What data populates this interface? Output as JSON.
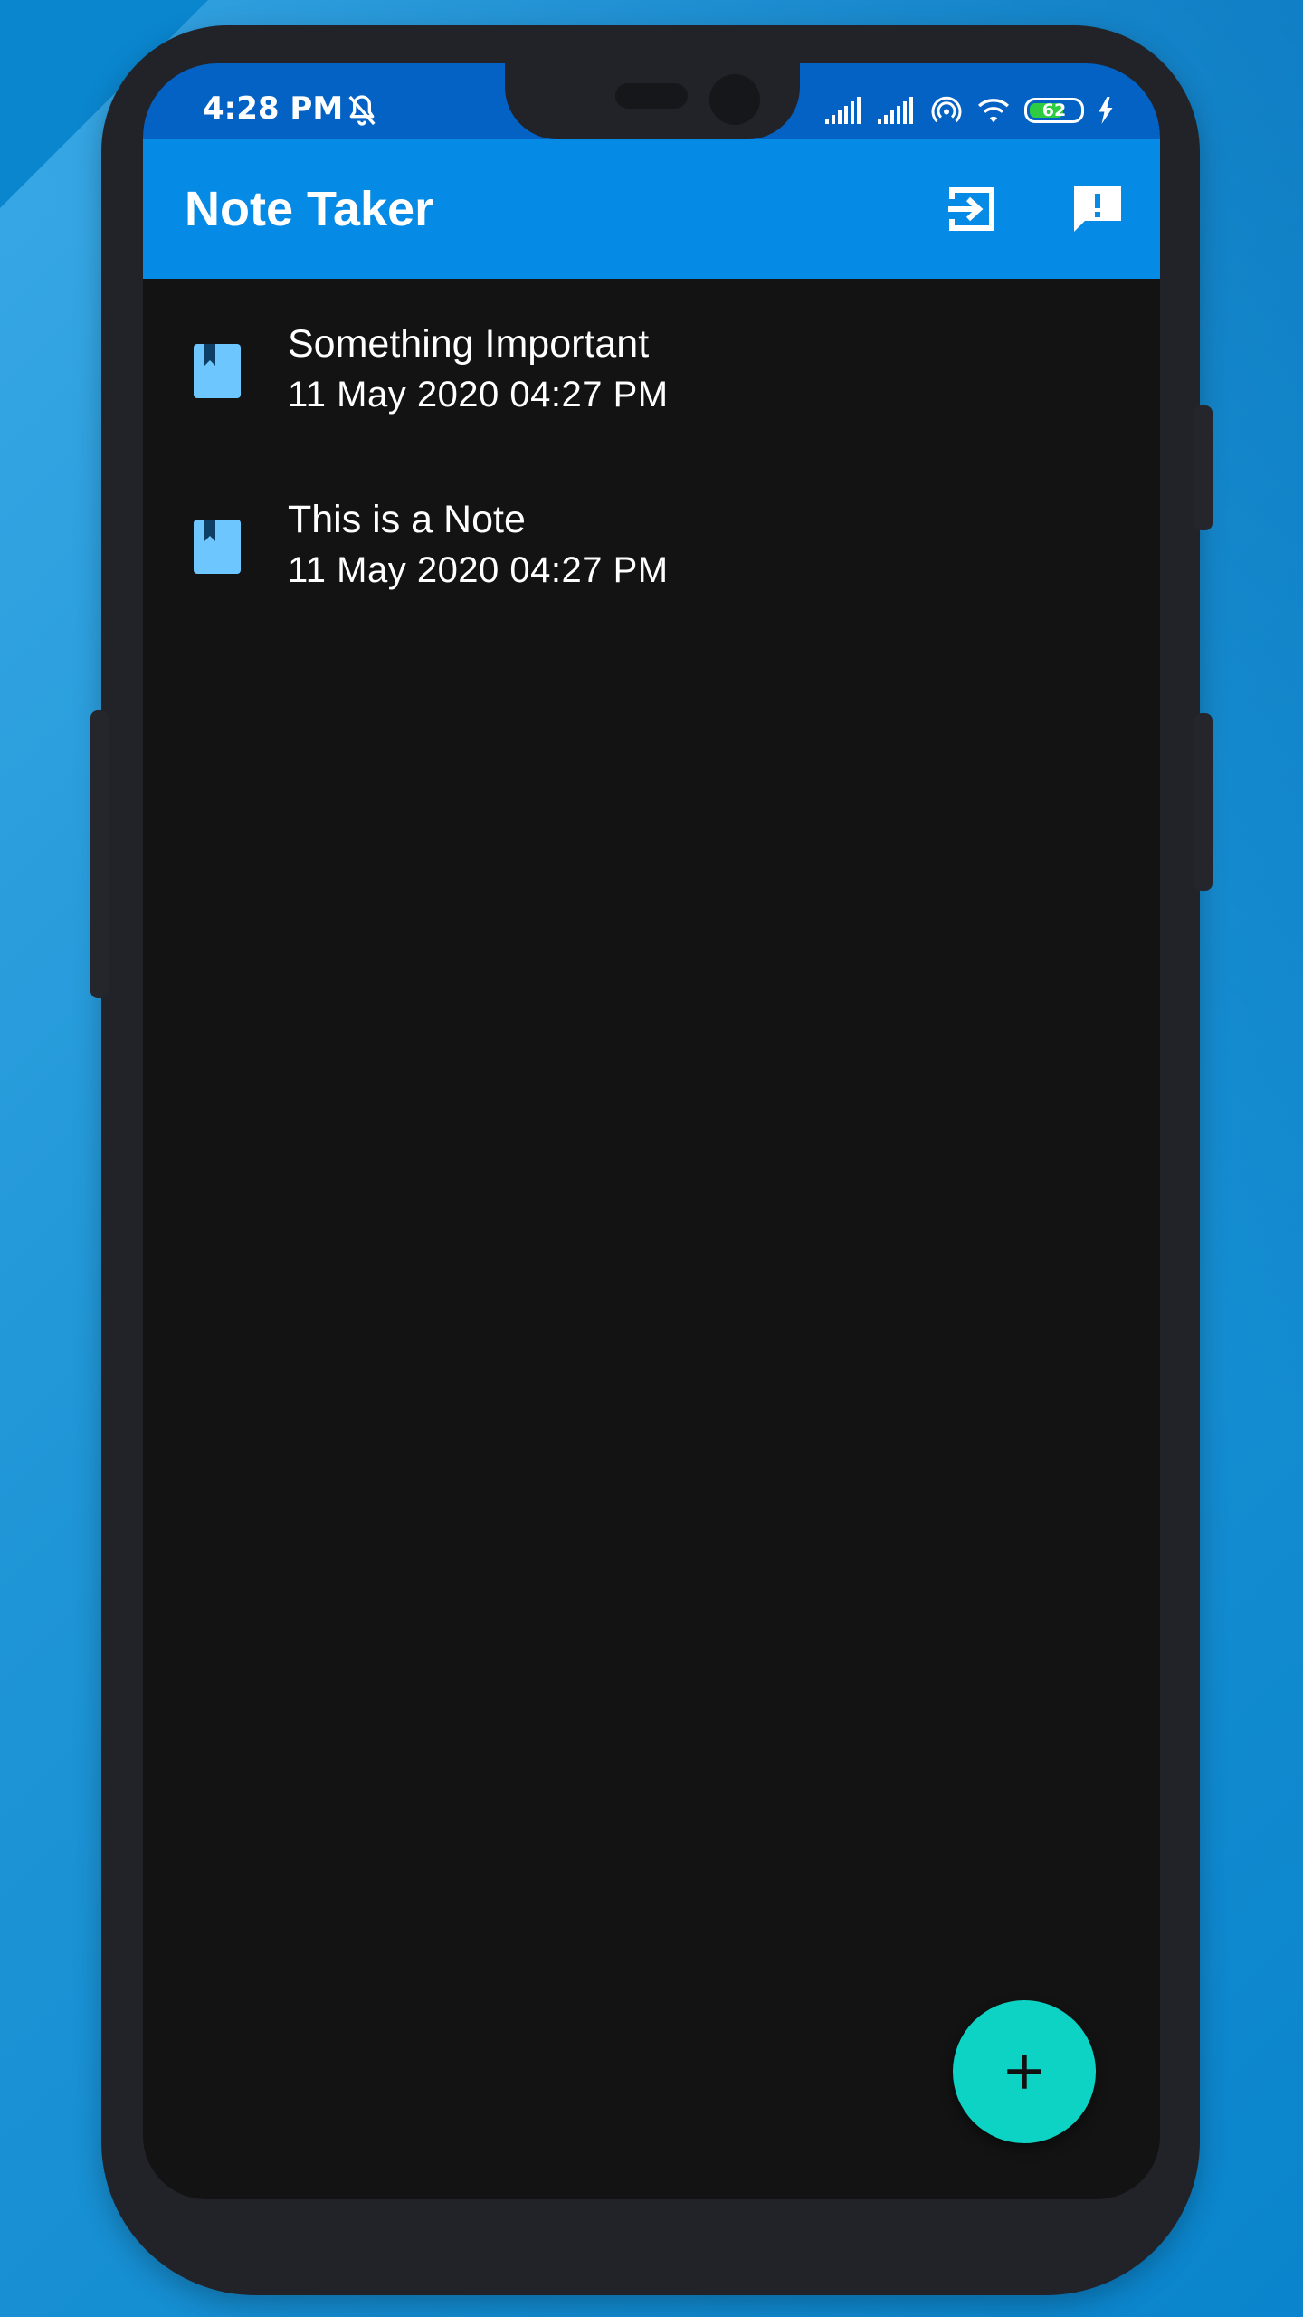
{
  "status_bar": {
    "time": "4:28 PM",
    "battery_level": "62",
    "icons": [
      "bell-off-icon",
      "signal-icon",
      "signal-icon",
      "hotspot-icon",
      "wifi-icon",
      "battery-icon",
      "charging-icon"
    ]
  },
  "app_bar": {
    "title": "Note Taker",
    "actions": [
      {
        "icon": "logout-icon"
      },
      {
        "icon": "feedback-icon"
      }
    ]
  },
  "notes": [
    {
      "title": "Something Important",
      "date": "11 May 2020 04:27 PM",
      "icon": "book-icon"
    },
    {
      "title": "This is a Note",
      "date": "11 May 2020 04:27 PM",
      "icon": "book-icon"
    }
  ],
  "fab": {
    "icon": "plus-icon"
  },
  "colors": {
    "status_bar": "#0462c4",
    "app_bar": "#058be6",
    "background": "#131313",
    "note_icon": "#6ec6ff",
    "fab": "#0dd3c4"
  }
}
